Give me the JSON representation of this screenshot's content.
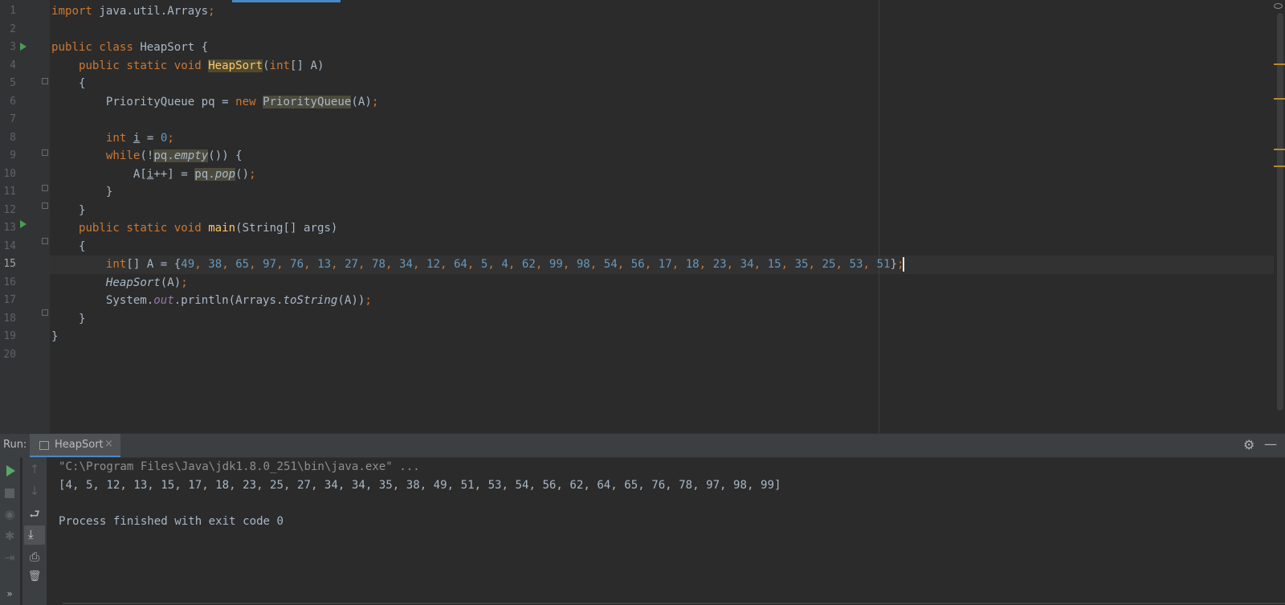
{
  "editor": {
    "file": "HeapSort",
    "lines": [
      {
        "n": "1",
        "html": "<span class=\"kw\">import</span> java.util.Arrays<span class=\"kw\">;</span>"
      },
      {
        "n": "2",
        "html": ""
      },
      {
        "n": "3",
        "html": "<span class=\"kw\">public class</span> HeapSort {"
      },
      {
        "n": "4",
        "html": "    <span class=\"kw\">public static void</span> <span class=\"hl2\">HeapSort</span>(<span class=\"kw\">int</span>[] A)"
      },
      {
        "n": "5",
        "html": "    {"
      },
      {
        "n": "6",
        "html": "        PriorityQueue pq = <span class=\"kw\">new</span> <span class=\"hl\">PriorityQueue</span>(A)<span class=\"kw\">;</span>"
      },
      {
        "n": "7",
        "html": ""
      },
      {
        "n": "8",
        "html": "        <span class=\"kw\">int</span> <span class=\"underline\">i</span> = <span class=\"num\">0</span><span class=\"kw\">;</span>"
      },
      {
        "n": "9",
        "html": "        <span class=\"kw\">while</span>(!<span class=\"hl\">pq.<span class=\"ital\">empty</span></span>()) {"
      },
      {
        "n": "10",
        "html": "            A[<span class=\"underline\">i</span>++] = <span class=\"hl\">pq.<span class=\"ital\">pop</span></span>()<span class=\"kw\">;</span>"
      },
      {
        "n": "11",
        "html": "        }"
      },
      {
        "n": "12",
        "html": "    }"
      },
      {
        "n": "13",
        "html": "    <span class=\"kw\">public static void</span> <span class=\"fn\">main</span>(String[] args)"
      },
      {
        "n": "14",
        "html": "    {"
      },
      {
        "n": "15",
        "html": "        <span class=\"kw\">int</span>[] A = {<span class=\"num\">49</span><span class=\"kw\">, </span><span class=\"num\">38</span><span class=\"kw\">, </span><span class=\"num\">65</span><span class=\"kw\">, </span><span class=\"num\">97</span><span class=\"kw\">, </span><span class=\"num\">76</span><span class=\"kw\">, </span><span class=\"num\">13</span><span class=\"kw\">, </span><span class=\"num\">27</span><span class=\"kw\">, </span><span class=\"num\">78</span><span class=\"kw\">, </span><span class=\"num\">34</span><span class=\"kw\">, </span><span class=\"num\">12</span><span class=\"kw\">, </span><span class=\"num\">64</span><span class=\"kw\">, </span><span class=\"num\">5</span><span class=\"kw\">, </span><span class=\"num\">4</span><span class=\"kw\">, </span><span class=\"num\">62</span><span class=\"kw\">, </span><span class=\"num\">99</span><span class=\"kw\">, </span><span class=\"num\">98</span><span class=\"kw\">, </span><span class=\"num\">54</span><span class=\"kw\">, </span><span class=\"num\">56</span><span class=\"kw\">, </span><span class=\"num\">17</span><span class=\"kw\">, </span><span class=\"num\">18</span><span class=\"kw\">, </span><span class=\"num\">23</span><span class=\"kw\">, </span><span class=\"num\">34</span><span class=\"kw\">, </span><span class=\"num\">15</span><span class=\"kw\">, </span><span class=\"num\">35</span><span class=\"kw\">, </span><span class=\"num\">25</span><span class=\"kw\">, </span><span class=\"num\">53</span><span class=\"kw\">, </span><span class=\"num\">51</span>}<span class=\"kw\">;</span>"
      },
      {
        "n": "16",
        "html": "        <span class=\"ital\">HeapSort</span>(A)<span class=\"kw\">;</span>"
      },
      {
        "n": "17",
        "html": "        System.<span class=\"field\">out</span>.println(Arrays.<span class=\"ital\">toString</span>(A))<span class=\"kw\">;</span>"
      },
      {
        "n": "18",
        "html": "    }"
      },
      {
        "n": "19",
        "html": "}"
      },
      {
        "n": "20",
        "html": ""
      }
    ],
    "current_line": "15"
  },
  "run": {
    "label": "Run:",
    "tab_label": "HeapSort",
    "tab_close": "×",
    "console": [
      "\"C:\\Program Files\\Java\\jdk1.8.0_251\\bin\\java.exe\" ...",
      "[4, 5, 12, 13, 15, 17, 18, 23, 25, 27, 34, 34, 35, 38, 49, 51, 53, 54, 56, 62, 64, 65, 76, 78, 97, 98, 99]",
      "",
      "Process finished with exit code 0"
    ]
  },
  "icons": {
    "gear": "⚙",
    "minimize": "—",
    "up": "↑",
    "down": "↓",
    "soft_wrap": "⮐",
    "scroll_end": "⤓",
    "print": "⎙",
    "trash": "🗑",
    "camera": "◉",
    "bug": "✱",
    "exit": "⇥",
    "more": "»"
  },
  "colors": {
    "keyword": "#cc7832",
    "number": "#6897bb",
    "method_decl": "#ffc66d",
    "text": "#a9b7c6",
    "background": "#2b2b2b"
  }
}
